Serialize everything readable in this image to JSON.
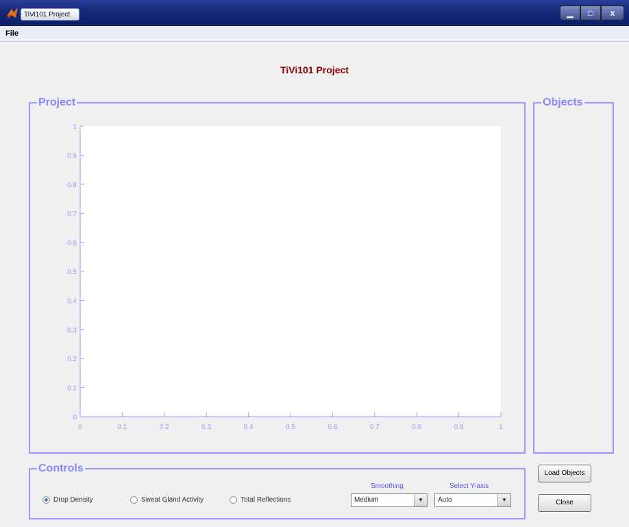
{
  "window": {
    "title": "TiVi101 Project"
  },
  "window_controls": {
    "minimize": "▁",
    "maximize": "□",
    "close": "x"
  },
  "menu": {
    "file": "File"
  },
  "app_title": "TiVi101 Project",
  "panels": {
    "project": "Project",
    "objects": "Objects",
    "controls": "Controls"
  },
  "chart_data": {
    "type": "line",
    "series": [],
    "xlim": [
      0,
      1
    ],
    "ylim": [
      0,
      1
    ],
    "x_ticks": [
      "0",
      "0.1",
      "0.2",
      "0.3",
      "0.4",
      "0.5",
      "0.6",
      "0.7",
      "0.8",
      "0.9",
      "1"
    ],
    "y_ticks": [
      "0",
      "0.1",
      "0.2",
      "0.3",
      "0.4",
      "0.5",
      "0.6",
      "0.7",
      "0.8",
      "0.9",
      "1"
    ],
    "grid": false,
    "axis_color": "#9999ff"
  },
  "controls": {
    "radios": [
      {
        "label": "Drop Density",
        "checked": true
      },
      {
        "label": "Sweat Gland Activity",
        "checked": false
      },
      {
        "label": "Total Reflections",
        "checked": false
      }
    ],
    "smoothing_label": "Smoothing",
    "smoothing_value": "Medium",
    "yaxis_label": "Select Y-axis",
    "yaxis_value": "Auto",
    "dropdown_arrow": "▼"
  },
  "buttons": {
    "load_objects": "Load Objects",
    "close": "Close"
  },
  "colors": {
    "panel_border": "#9999ff",
    "title": "#8b0000",
    "label": "#5555ee"
  }
}
